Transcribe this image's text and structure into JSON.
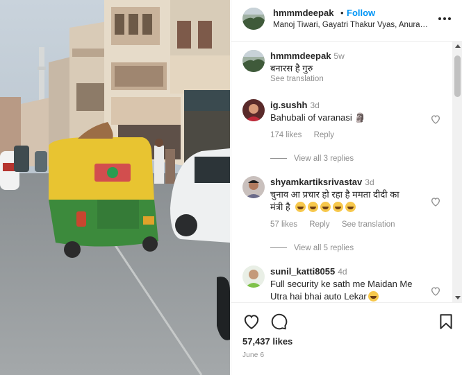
{
  "post": {
    "username": "hmmmdeepak",
    "separator": "•",
    "follow_label": "Follow",
    "audio": "Manoj Tiwari, Gayatri Thakur Vyas, Anura…",
    "more_icon": "more-horizontal-icon"
  },
  "comments": [
    {
      "username": "hmmmdeepak",
      "time": "5w",
      "text": "बनारस है गुरु",
      "see_translation": "See translation"
    },
    {
      "username": "ig.sushh",
      "time": "3d",
      "text": "Bahubali of varanasi 🗿",
      "likes": "174 likes",
      "reply": "Reply",
      "view_replies": "View all 3 replies"
    },
    {
      "username": "shyamkartiksrivastav",
      "time": "3d",
      "text_line1": "चुनाव आ प्रचार हो रहा है ममता दीदी का",
      "text_line2": "मंत्री है",
      "likes": "57 likes",
      "reply": "Reply",
      "see_translation": "See translation",
      "view_replies": "View all 5 replies"
    },
    {
      "username": "sunil_katti8055",
      "time": "4d",
      "text_line1": "Full security ke sath me Maidan Me",
      "text_line2": "Utra hai bhai auto Lekar"
    }
  ],
  "actions": {
    "likes": "57,437 likes",
    "date": "June 6"
  },
  "colors": {
    "accent": "#0095f6",
    "text": "#262626",
    "muted": "#8e8e8e"
  }
}
